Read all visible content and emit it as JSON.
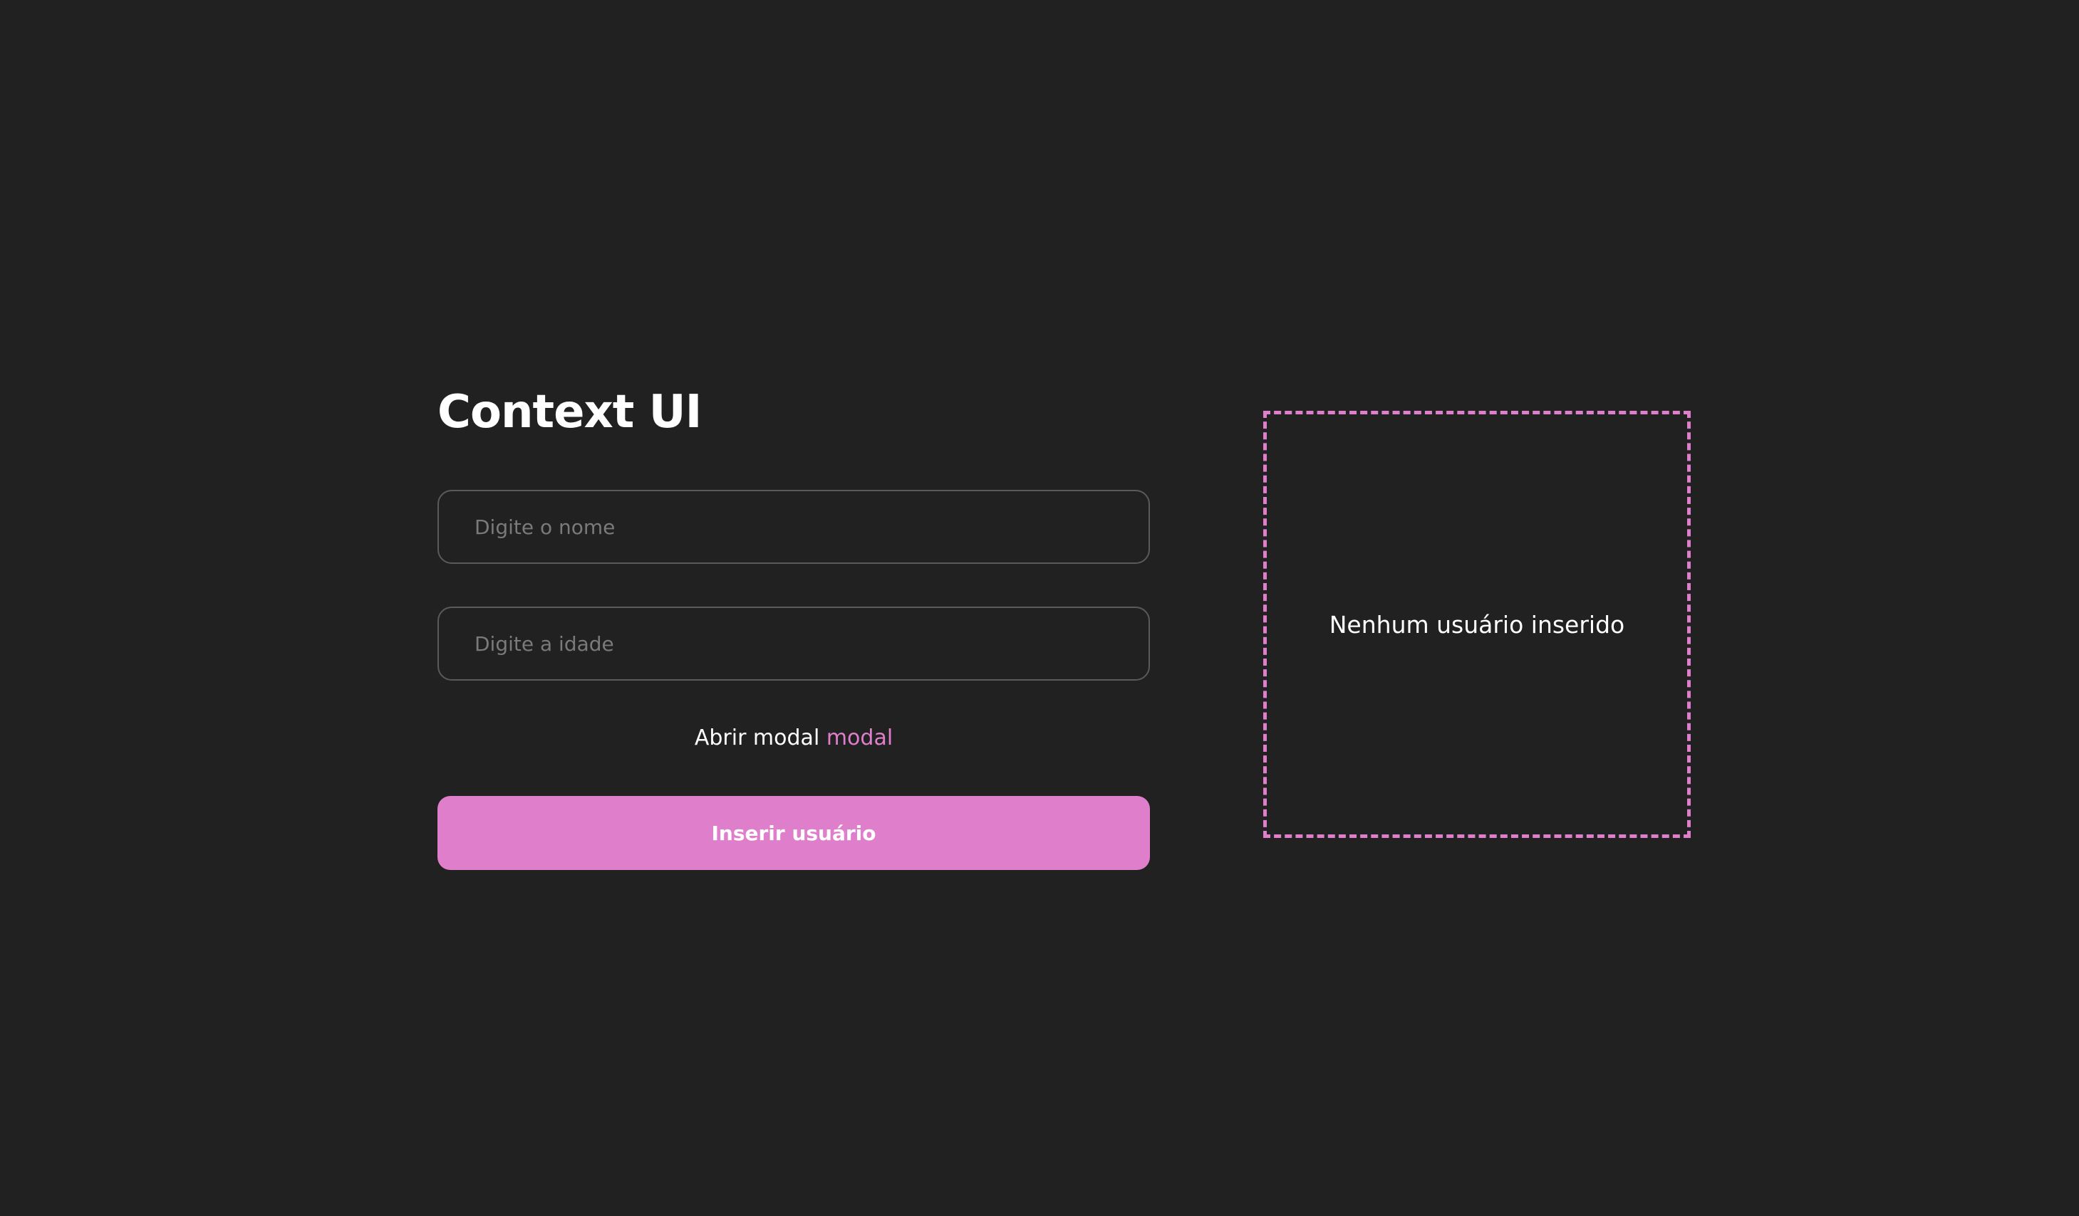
{
  "header": {
    "title": "Context UI"
  },
  "form": {
    "name_placeholder": "Digite o nome",
    "age_placeholder": "Digite a idade",
    "name_value": "",
    "age_value": "",
    "modal_text": "Abrir modal",
    "modal_link": "modal",
    "submit_label": "Inserir usuário"
  },
  "users_panel": {
    "empty_message": "Nenhum usuário inserido"
  },
  "colors": {
    "background": "#212121",
    "accent": "#df7fcb",
    "text": "#ffffff",
    "input_border": "#5a5a5a",
    "placeholder": "#7a7a7a"
  }
}
